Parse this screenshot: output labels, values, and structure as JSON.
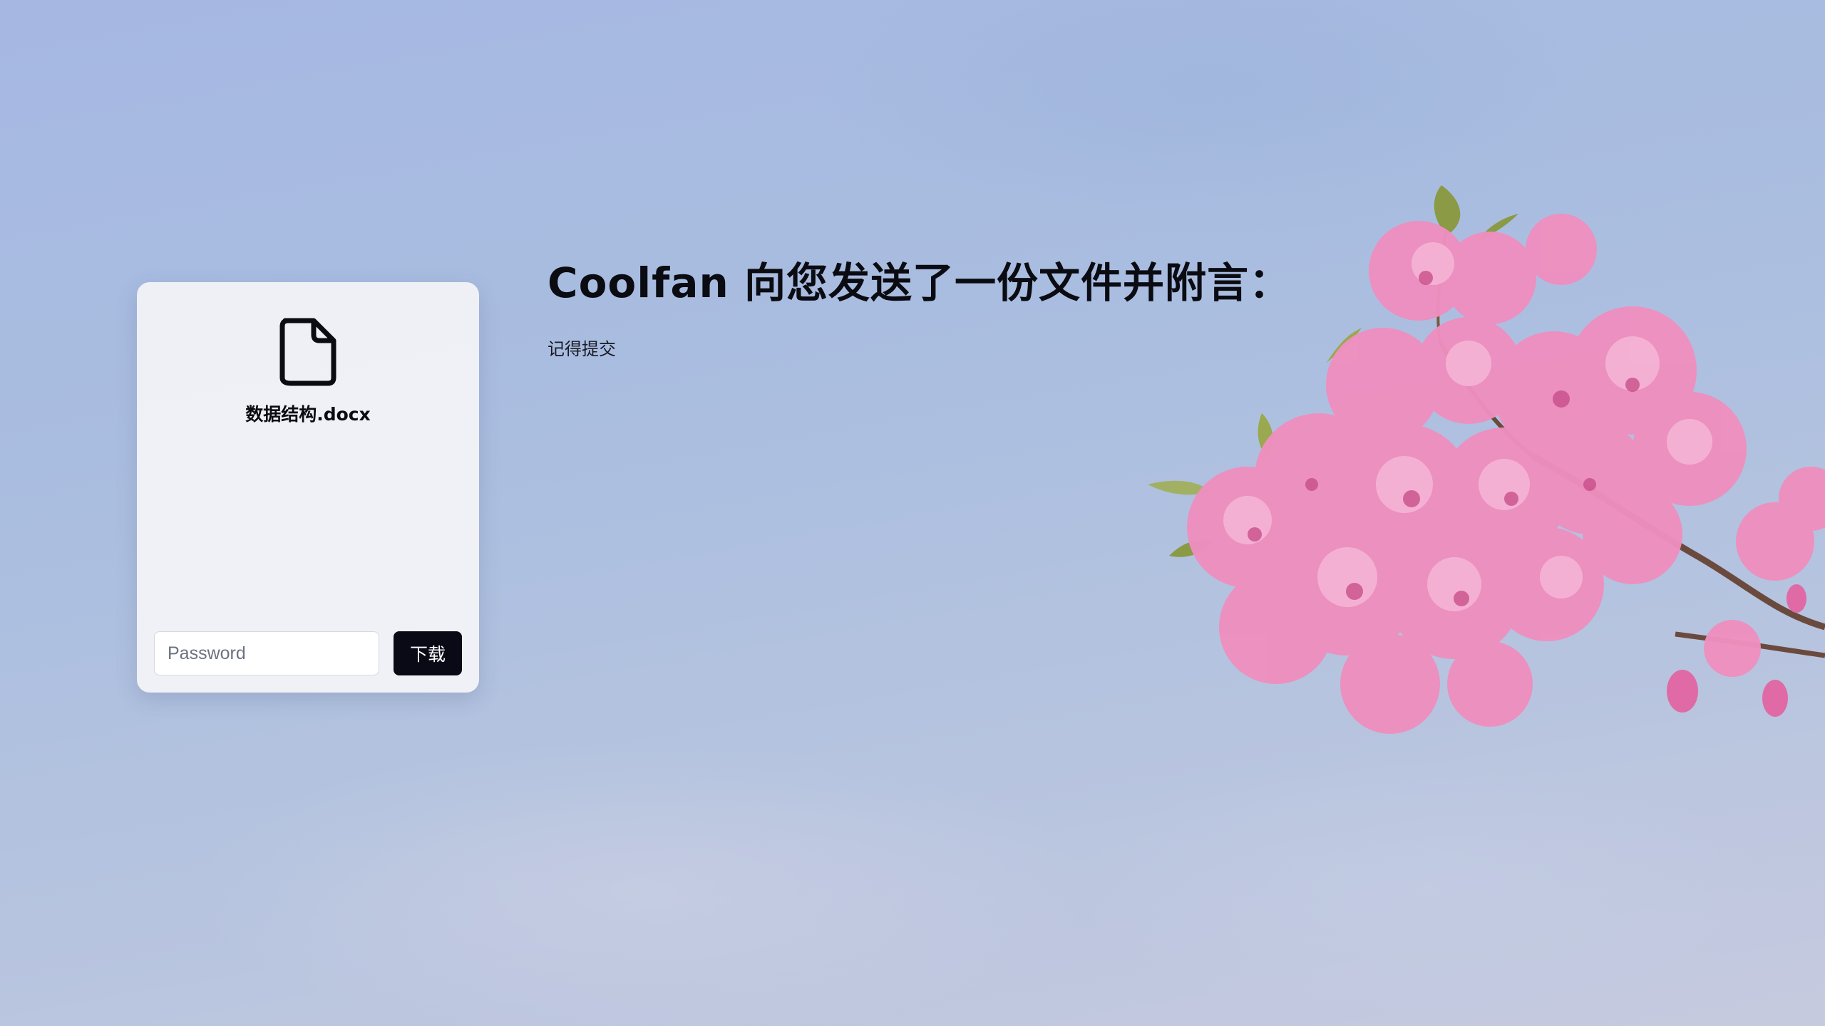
{
  "file_card": {
    "icon": "file-icon",
    "file_name": "数据结构.docx",
    "password_placeholder": "Password",
    "download_label": "下载"
  },
  "message": {
    "headline": "Coolfan 向您发送了一份文件并附言：",
    "note": "记得提交"
  },
  "background": {
    "image": "cherry-blossom-branch",
    "sky_color": "#a9bde0",
    "blossom_color": "#ee8fbf"
  }
}
